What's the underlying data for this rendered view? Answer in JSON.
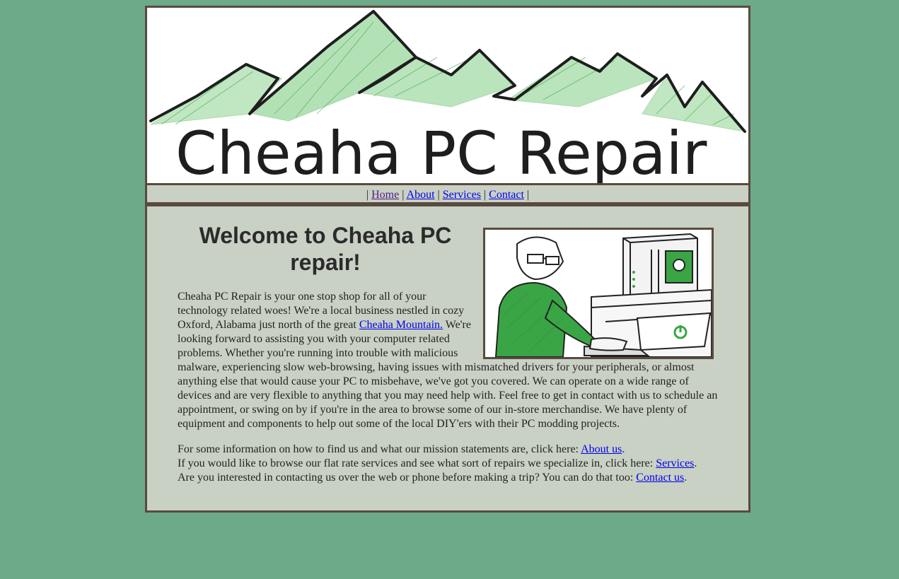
{
  "banner": {
    "title": "Cheaha PC Repair",
    "accent_green": "#3aa545",
    "line_color": "#1e1e1e"
  },
  "nav": {
    "separator": "|",
    "items": [
      {
        "label": "Home"
      },
      {
        "label": "About"
      },
      {
        "label": "Services"
      },
      {
        "label": "Contact"
      }
    ]
  },
  "main": {
    "heading": "Welcome to Cheaha PC repair!",
    "illustration_icon": "technician-at-computer-illustration",
    "intro": {
      "before_link": "Cheaha PC Repair is your one stop shop for all of your technology related woes! We're a local business nestled in cozy Oxford, Alabama just north of the great ",
      "link_text": "Cheaha Mountain.",
      "after_link": " We're looking forward to assisting you with your computer related problems. Whether you're running into trouble with malicious malware, experiencing slow web-browsing, having issues with mismatched drivers for your peripherals, or almost anything else that would cause your PC to misbehave, we've got you covered. We can operate on a wide range of devices and are very flexible to anything that you may need help with. Feel free to get in contact with us to schedule an appointment, or swing on by if you're in the area to browse some of our in-store merchandise. We have plenty of equipment and components to help out some of the local DIY'ers with their PC modding projects."
    },
    "lines": [
      {
        "text": "For some information on how to find us and what our mission statements are, click here: ",
        "link": "About us",
        "end": "."
      },
      {
        "text": "If you would like to browse our flat rate services and see what sort of repairs we specialize in, click here: ",
        "link": "Services",
        "end": "."
      },
      {
        "text": "Are you interested in contacting us over the web or phone before making a trip? You can do that too: ",
        "link": "Contact us",
        "end": "."
      }
    ]
  },
  "colors": {
    "page_background": "#6daa89",
    "panel_background": "#c9d1c4",
    "border": "#594a40",
    "link": "#0000ee",
    "visited_link": "#551a8b"
  }
}
